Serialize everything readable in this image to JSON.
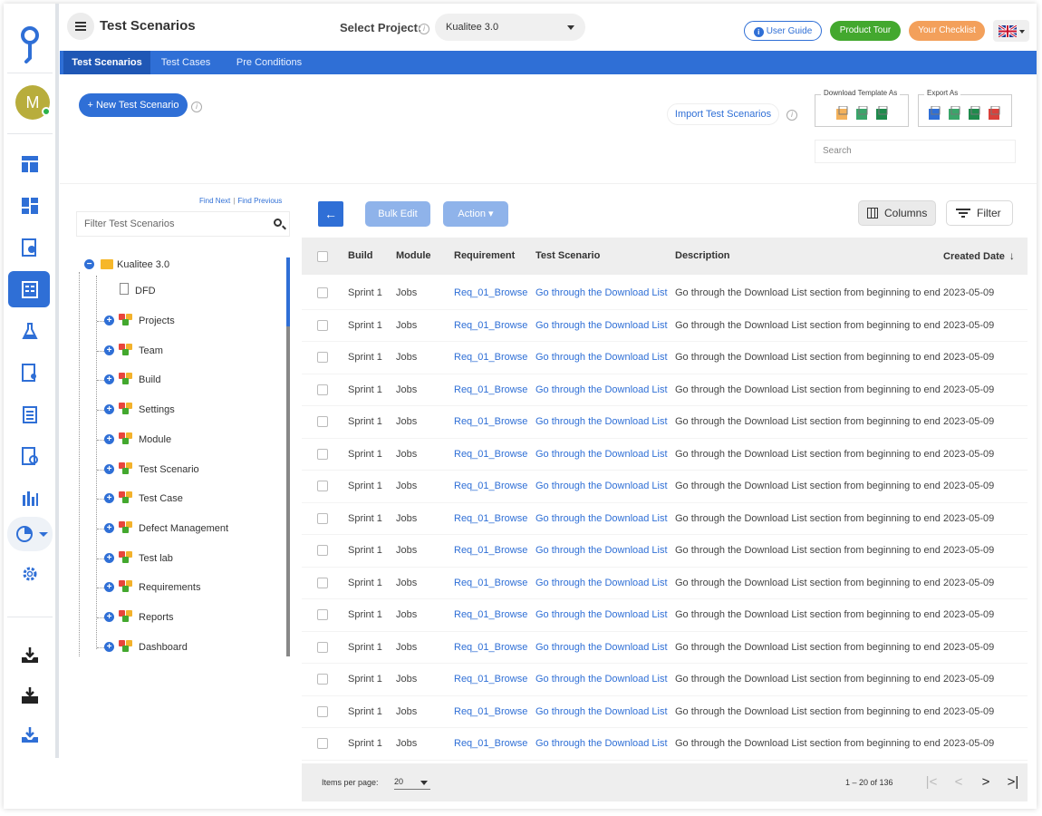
{
  "header": {
    "title": "Test Scenarios",
    "project_label": "Select Project:",
    "project_value": "Kualitee 3.0",
    "user_guide": "User Guide",
    "product_tour": "Product Tour",
    "checklist": "Your Checklist"
  },
  "rail": {
    "avatar_letter": "M"
  },
  "tabs": [
    {
      "label": "Test Scenarios",
      "active": true
    },
    {
      "label": "Test Cases",
      "active": false
    },
    {
      "label": "Pre Conditions",
      "active": false
    }
  ],
  "toolbar": {
    "new_label": "+ New Test Scenario",
    "import_label": "Import Test Scenarios",
    "download_template_legend": "Download Template As",
    "export_legend": "Export As",
    "search_placeholder": "Search"
  },
  "tree": {
    "find_next": "Find Next",
    "find_previous": "Find Previous",
    "filter_placeholder": "Filter Test Scenarios",
    "root": "Kualitee 3.0",
    "doc": "DFD",
    "nodes": [
      "Projects",
      "Team",
      "Build",
      "Settings",
      "Module",
      "Test Scenario",
      "Test Case",
      "Defect Management",
      "Test lab",
      "Requirements",
      "Reports",
      "Dashboard"
    ]
  },
  "grid": {
    "bulk_edit": "Bulk Edit",
    "action": "Action ▾",
    "columns": "Columns",
    "filter": "Filter",
    "headers": [
      "Build",
      "Module",
      "Requirement",
      "Test Scenario",
      "Description",
      "Created Date"
    ],
    "rows": [
      [
        "Sprint 1",
        "Jobs",
        "Req_01_Browse",
        "Go through the Download List",
        "Go through the Download List section from beginning to end",
        "2023-05-09"
      ],
      [
        "Sprint 1",
        "Jobs",
        "Req_01_Browse",
        "Go through the Download List",
        "Go through the Download List section from beginning to end",
        "2023-05-09"
      ],
      [
        "Sprint 1",
        "Jobs",
        "Req_01_Browse",
        "Go through the Download List",
        "Go through the Download List section from beginning to end",
        "2023-05-09"
      ],
      [
        "Sprint 1",
        "Jobs",
        "Req_01_Browse",
        "Go through the Download List",
        "Go through the Download List section from beginning to end",
        "2023-05-09"
      ],
      [
        "Sprint 1",
        "Jobs",
        "Req_01_Browse",
        "Go through the Download List",
        "Go through the Download List section from beginning to end",
        "2023-05-09"
      ],
      [
        "Sprint 1",
        "Jobs",
        "Req_01_Browse",
        "Go through the Download List",
        "Go through the Download List section from beginning to end",
        "2023-05-09"
      ],
      [
        "Sprint 1",
        "Jobs",
        "Req_01_Browse",
        "Go through the Download List",
        "Go through the Download List section from beginning to end",
        "2023-05-09"
      ],
      [
        "Sprint 1",
        "Jobs",
        "Req_01_Browse",
        "Go through the Download List",
        "Go through the Download List section from beginning to end",
        "2023-05-09"
      ],
      [
        "Sprint 1",
        "Jobs",
        "Req_01_Browse",
        "Go through the Download List",
        "Go through the Download List section from beginning to end",
        "2023-05-09"
      ],
      [
        "Sprint 1",
        "Jobs",
        "Req_01_Browse",
        "Go through the Download List",
        "Go through the Download List section from beginning to end",
        "2023-05-09"
      ],
      [
        "Sprint 1",
        "Jobs",
        "Req_01_Browse",
        "Go through the Download List",
        "Go through the Download List section from beginning to end",
        "2023-05-09"
      ],
      [
        "Sprint 1",
        "Jobs",
        "Req_01_Browse",
        "Go through the Download List",
        "Go through the Download List section from beginning to end",
        "2023-05-09"
      ],
      [
        "Sprint 1",
        "Jobs",
        "Req_01_Browse",
        "Go through the Download List",
        "Go through the Download List section from beginning to end",
        "2023-05-09"
      ],
      [
        "Sprint 1",
        "Jobs",
        "Req_01_Browse",
        "Go through the Download List",
        "Go through the Download List section from beginning to end",
        "2023-05-09"
      ],
      [
        "Sprint 1",
        "Jobs",
        "Req_01_Browse",
        "Go through the Download List",
        "Go through the Download List section from beginning to end",
        "2023-05-09"
      ]
    ]
  },
  "pager": {
    "items_per_page_label": "Items per page:",
    "items_per_page": "20",
    "range": "1 – 20 of 136"
  },
  "colors": {
    "primary": "#2f6fd6",
    "tour_green": "#43a82e",
    "checklist_orange": "#f3a05b",
    "avatar": "#b8ad3c"
  },
  "icons": {
    "rail": [
      "layout-icon",
      "dashboard-icon",
      "settings-gear-doc-icon",
      "test-scenarios-icon",
      "flask-icon",
      "doc-search-icon",
      "clipboard-icon",
      "doc-chart-icon",
      "bar-chart-icon",
      "pie-chart-icon",
      "gear-icon",
      "download-tray-icon",
      "download-box-icon",
      "inbox-download-icon"
    ]
  }
}
